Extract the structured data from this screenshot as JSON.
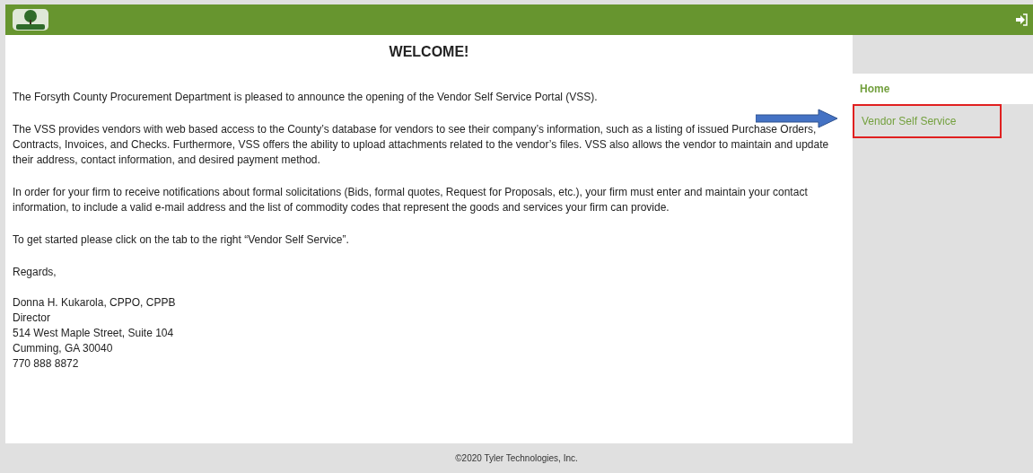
{
  "content": {
    "title": "WELCOME!",
    "paragraphs": [
      "The Forsyth County Procurement Department is pleased to announce the opening of the Vendor Self Service Portal (VSS).",
      "The VSS provides vendors with web based access to the County’s database for vendors to see their company’s information, such as a listing of issued Purchase Orders, Contracts, Invoices, and Checks. Furthermore, VSS offers the ability to upload attachments related to the vendor’s files. VSS also allows the vendor to maintain and update their address, contact information, and desired payment method.",
      "In order for your firm to receive notifications about formal solicitations (Bids, formal quotes, Request for Proposals, etc.), your firm must enter and maintain your contact information, to include a valid e-mail address and the list of commodity codes that represent the goods and services your firm can provide.",
      "To get started please click on the tab to the right “Vendor Self Service”.",
      "Regards,"
    ],
    "signature": [
      "Donna H. Kukarola, CPPO, CPPB",
      "Director",
      "514 West Maple Street, Suite 104",
      "Cumming, GA 30040",
      "770 888 8872"
    ]
  },
  "sidebar": {
    "items": [
      {
        "label": "Home",
        "selected": true,
        "highlighted": false
      },
      {
        "label": "Vendor Self Service",
        "selected": false,
        "highlighted": true
      }
    ]
  },
  "footer": "©2020 Tyler Technologies, Inc."
}
